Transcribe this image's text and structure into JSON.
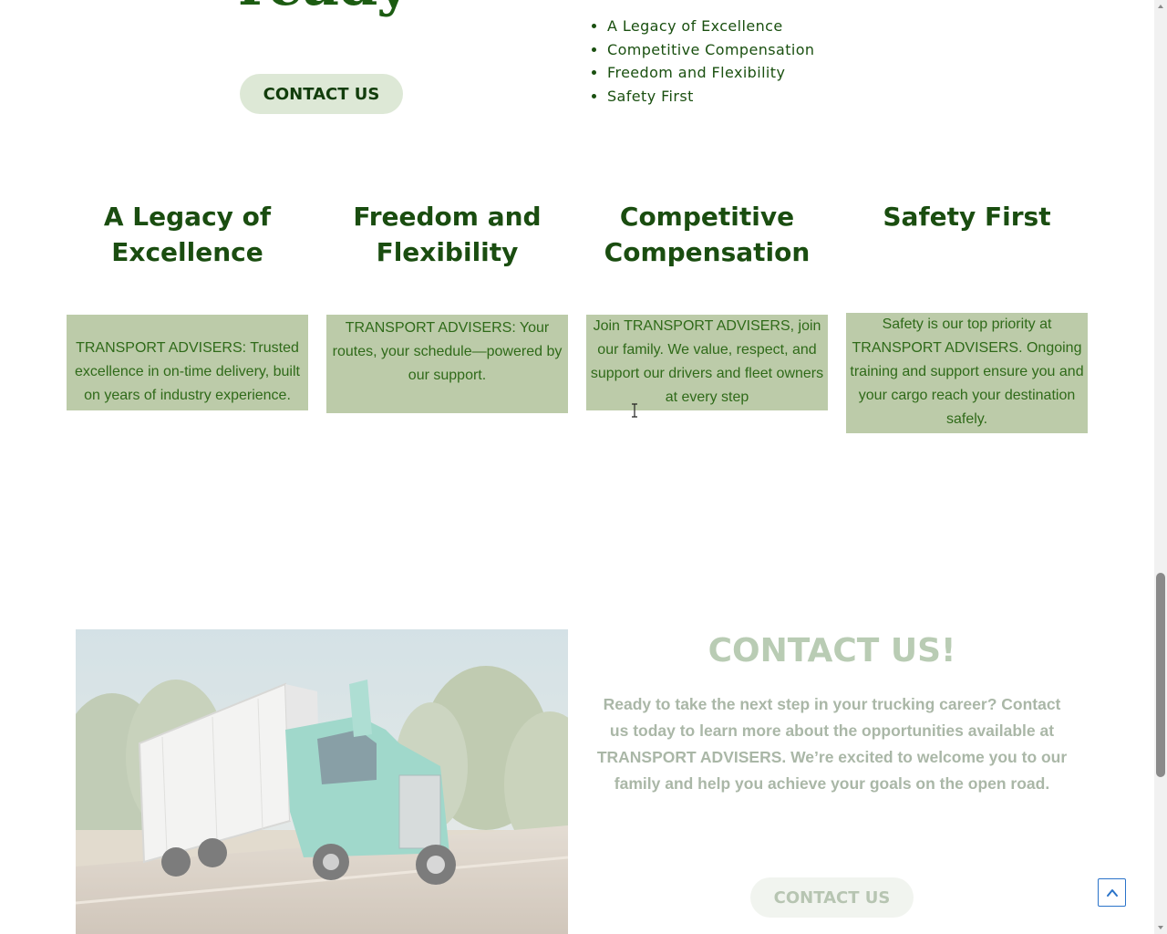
{
  "hero": {
    "heading_fragment": "ready",
    "cta_label": "CONTACT US",
    "benefits": [
      "A Legacy of Excellence",
      "Competitive Compensation",
      "Freedom and Flexibility",
      "Safety First"
    ]
  },
  "features": [
    {
      "title": "A Legacy of Excellence",
      "text": "TRANSPORT ADVISERS: Trusted excellence in on-time delivery, built on years of industry experience."
    },
    {
      "title": "Freedom and Flexibility",
      "text": "TRANSPORT ADVISERS: Your routes, your schedule—powered by our support."
    },
    {
      "title": "Competitive Compensation",
      "text": "Join TRANSPORT ADVISERS, join our family. We value, respect, and support our drivers and fleet owners at every step"
    },
    {
      "title": "Safety First",
      "text": "Safety is our top priority at TRANSPORT ADVISERS. Ongoing training and support ensure you and your cargo reach your destination safely."
    }
  ],
  "contact": {
    "title": "CONTACT US!",
    "text": "Ready to take the next step in your trucking career? Contact us today to learn more about the opportunities available at TRANSPORT ADVISERS. We’re excited to welcome you to our family and help you achieve your goals on the open road.",
    "cta_label": "CONTACT US"
  },
  "colors": {
    "brand_green": "#1a4d10",
    "feature_box_bg": "#bccba9",
    "pill_bg": "#dde8d6",
    "scroll_top_border": "#2a73c9"
  },
  "icons": {
    "scroll_top": "chevron-up-icon",
    "cursor": "text-cursor-icon"
  }
}
